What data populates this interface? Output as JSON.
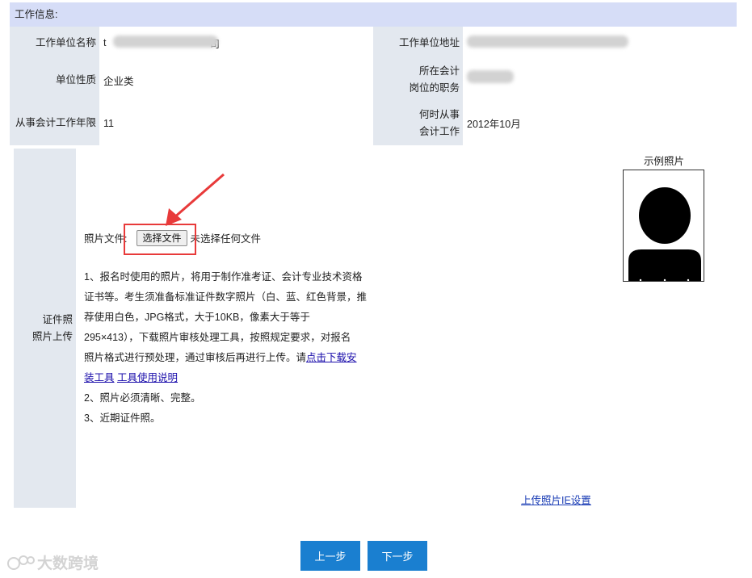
{
  "work_info": {
    "section_title": "工作信息:",
    "employer_name": {
      "label": "工作单位名称",
      "value_prefix": "t",
      "value_suffix": "司"
    },
    "employer_address": {
      "label": "工作单位地址"
    },
    "unit_type": {
      "label": "单位性质",
      "value": "企业类"
    },
    "position": {
      "label_line1": "所在会计",
      "label_line2": "岗位的职务"
    },
    "years": {
      "label": "从事会计工作年限",
      "value": "11"
    },
    "start_time": {
      "label_line1": "何时从事",
      "label_line2": "会计工作",
      "value": "2012年10月"
    }
  },
  "photo_upload": {
    "label_line1": "证件照",
    "label_line2": "照片上传",
    "file_label": "照片文件:",
    "choose_button": "选择文件",
    "no_file_text": "未选择任何文件",
    "sample_title": "示例照片",
    "notes": {
      "n1_line1": "1、报名时使用的照片，将用于制作准考证、会计专业技术资格",
      "n1_line2": "证书等。考生须准备标准证件数字照片（白、蓝、红色背景，推",
      "n1_line3": "荐使用白色，JPG格式，大于10KB，像素大于等于",
      "n1_line4": "295×413），下载照片审核处理工具，按照规定要求，对报名",
      "n1_line5_text": "照片格式进行预处理，通过审核后再进行上传。请",
      "n1_link_a1": "点击下载安",
      "n1_link_a2": "装工具",
      "n1_link_b": "工具使用说明",
      "n2": "2、照片必须清晰、完整。",
      "n3": "3、近期证件照。"
    },
    "ie_settings_link": "上传照片IE设置"
  },
  "navigation": {
    "prev": "上一步",
    "next": "下一步"
  },
  "watermark": "大数跨境",
  "colors": {
    "header_bg": "#d6ddf7",
    "label_bg": "#e3e8ef",
    "button_blue": "#1a7fd0",
    "annotation_red": "#e83a3a"
  }
}
